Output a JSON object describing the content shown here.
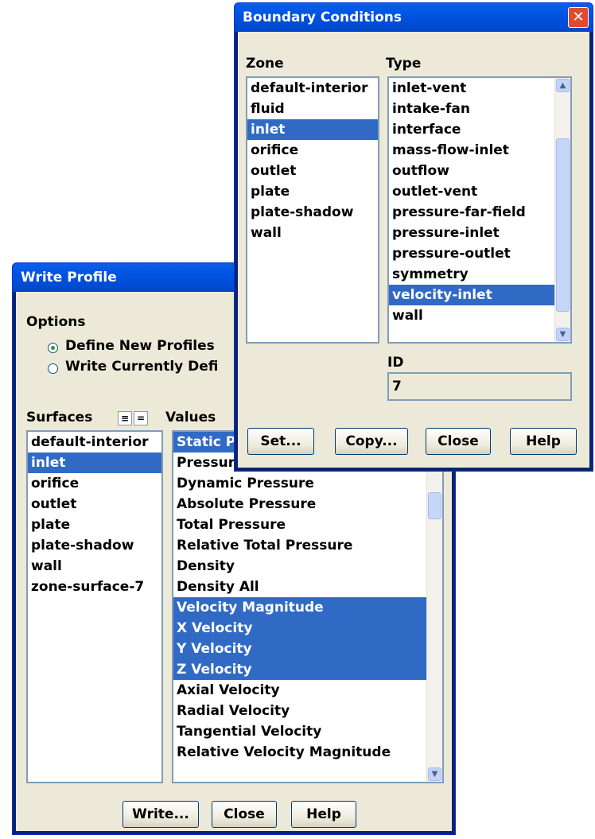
{
  "write_profile": {
    "title": "Write Profile",
    "options_label": "Options",
    "radio_define": "Define New Profiles",
    "radio_write": "Write Currently Defi",
    "surfaces_label": "Surfaces",
    "surfaces_btn_all": "≡",
    "surfaces_btn_none": "=",
    "values_label": "Values",
    "surfaces": [
      "default-interior",
      "inlet",
      "orifice",
      "outlet",
      "plate",
      "plate-shadow",
      "wall",
      "zone-surface-7"
    ],
    "values": [
      "Static Pressure",
      "Pressure Coefficient",
      "Dynamic Pressure",
      "Absolute Pressure",
      "Total Pressure",
      "Relative Total Pressure",
      "Density",
      "Density All",
      "Velocity Magnitude",
      "X Velocity",
      "Y Velocity",
      "Z Velocity",
      "Axial Velocity",
      "Radial Velocity",
      "Tangential Velocity",
      "Relative Velocity Magnitude"
    ],
    "buttons": {
      "write": "Write...",
      "close": "Close",
      "help": "Help"
    }
  },
  "boundary_conditions": {
    "title": "Boundary Conditions",
    "zone_label": "Zone",
    "type_label": "Type",
    "zones": [
      "default-interior",
      "fluid",
      "inlet",
      "orifice",
      "outlet",
      "plate",
      "plate-shadow",
      "wall"
    ],
    "types": [
      "inlet-vent",
      "intake-fan",
      "interface",
      "mass-flow-inlet",
      "outflow",
      "outlet-vent",
      "pressure-far-field",
      "pressure-inlet",
      "pressure-outlet",
      "symmetry",
      "velocity-inlet",
      "wall"
    ],
    "id_label": "ID",
    "id_value": "7",
    "buttons": {
      "set": "Set...",
      "copy": "Copy...",
      "close": "Close",
      "help": "Help"
    }
  },
  "colors": {
    "titlebar": "#0054e3",
    "selection": "#316ac5",
    "dialog_bg": "#ece9d8"
  }
}
